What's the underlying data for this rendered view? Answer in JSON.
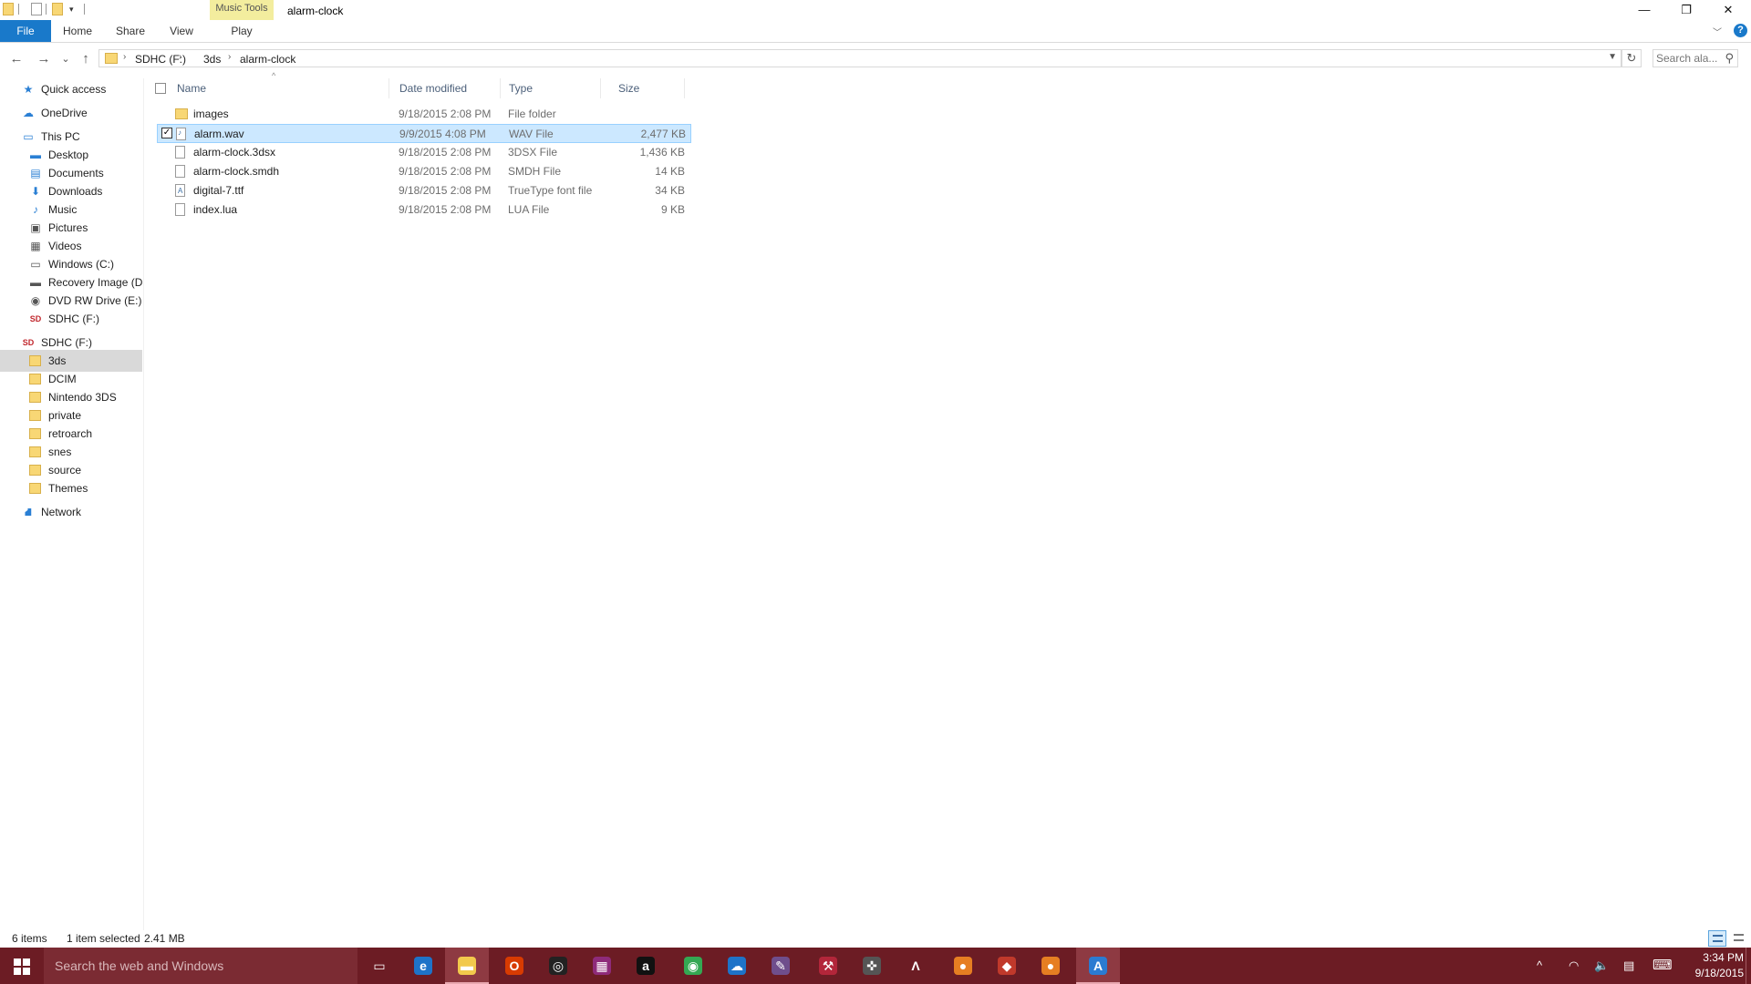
{
  "window": {
    "title": "alarm-clock",
    "contextual_tab_group": "Music Tools",
    "controls": {
      "minimize": "—",
      "restore": "❐",
      "close": "✕"
    }
  },
  "ribbon": {
    "tabs": [
      "File",
      "Home",
      "Share",
      "View",
      "Play"
    ],
    "collapse_icon": "chevron-down-icon",
    "help": "?"
  },
  "nav": {
    "back": "←",
    "forward": "→",
    "recent": "⌄",
    "up": "↑",
    "breadcrumb": [
      "SDHC (F:)",
      "3ds",
      "alarm-clock"
    ],
    "refresh": "↻"
  },
  "search": {
    "placeholder": "Search ala..."
  },
  "sidebar": {
    "items": [
      {
        "label": "Quick access",
        "icon": "star-icon",
        "glyph": "★"
      },
      {
        "label": "OneDrive",
        "icon": "cloud-icon",
        "glyph": "☁"
      },
      {
        "label": "This PC",
        "icon": "computer-icon",
        "glyph": "▭"
      },
      {
        "label": "Desktop",
        "icon": "desktop-icon",
        "glyph": "▬"
      },
      {
        "label": "Documents",
        "icon": "document-icon",
        "glyph": "▤"
      },
      {
        "label": "Downloads",
        "icon": "download-icon",
        "glyph": "⬇"
      },
      {
        "label": "Music",
        "icon": "music-icon",
        "glyph": "♪"
      },
      {
        "label": "Pictures",
        "icon": "picture-icon",
        "glyph": "▣"
      },
      {
        "label": "Videos",
        "icon": "video-icon",
        "glyph": "▦"
      },
      {
        "label": "Windows (C:)",
        "icon": "drive-icon",
        "glyph": "▭"
      },
      {
        "label": "Recovery Image (D:",
        "icon": "drive-icon",
        "glyph": "▬"
      },
      {
        "label": "DVD RW Drive (E:) A",
        "icon": "dvd-icon",
        "glyph": "◉"
      },
      {
        "label": "SDHC (F:)",
        "icon": "sd-card-icon",
        "glyph": "SD"
      },
      {
        "label": "SDHC (F:)",
        "icon": "sd-card-icon",
        "glyph": "SD"
      },
      {
        "label": "3ds",
        "icon": "folder-icon",
        "glyph": ""
      },
      {
        "label": "DCIM",
        "icon": "folder-icon",
        "glyph": ""
      },
      {
        "label": "Nintendo 3DS",
        "icon": "folder-icon",
        "glyph": ""
      },
      {
        "label": "private",
        "icon": "folder-icon",
        "glyph": ""
      },
      {
        "label": "retroarch",
        "icon": "folder-icon",
        "glyph": ""
      },
      {
        "label": "snes",
        "icon": "folder-icon",
        "glyph": ""
      },
      {
        "label": "source",
        "icon": "folder-icon",
        "glyph": ""
      },
      {
        "label": "Themes",
        "icon": "folder-icon",
        "glyph": ""
      },
      {
        "label": "Network",
        "icon": "network-icon",
        "glyph": "⛘"
      }
    ]
  },
  "filelist": {
    "headers": {
      "name": "Name",
      "date": "Date modified",
      "type": "Type",
      "size": "Size"
    },
    "sort_indicator": "^",
    "rows": [
      {
        "name": "images",
        "date": "9/18/2015 2:08 PM",
        "type": "File folder",
        "size": "",
        "icon": "folder-icon",
        "selected": false
      },
      {
        "name": "alarm.wav",
        "date": "9/9/2015 4:08 PM",
        "type": "WAV File",
        "size": "2,477 KB",
        "icon": "audio-file-icon",
        "selected": true
      },
      {
        "name": "alarm-clock.3dsx",
        "date": "9/18/2015 2:08 PM",
        "type": "3DSX File",
        "size": "1,436 KB",
        "icon": "file-icon",
        "selected": false
      },
      {
        "name": "alarm-clock.smdh",
        "date": "9/18/2015 2:08 PM",
        "type": "SMDH File",
        "size": "14 KB",
        "icon": "file-icon",
        "selected": false
      },
      {
        "name": "digital-7.ttf",
        "date": "9/18/2015 2:08 PM",
        "type": "TrueType font file",
        "size": "34 KB",
        "icon": "font-file-icon",
        "selected": false
      },
      {
        "name": "index.lua",
        "date": "9/18/2015 2:08 PM",
        "type": "LUA File",
        "size": "9 KB",
        "icon": "file-icon",
        "selected": false
      }
    ],
    "check_mark": "✓"
  },
  "status": {
    "item_count": "6 items",
    "selection": "1 item selected",
    "selection_size": "2.41 MB"
  },
  "taskbar": {
    "search_placeholder": "Search the web and Windows",
    "apps": [
      {
        "name": "task-view-icon",
        "glyph": "▭",
        "bg": ""
      },
      {
        "name": "edge-browser-icon",
        "glyph": "e",
        "bg": "#1e73c8"
      },
      {
        "name": "file-explorer-icon",
        "glyph": "▬",
        "bg": "#f2c94c"
      },
      {
        "name": "office-icon",
        "glyph": "O",
        "bg": "#d83b01"
      },
      {
        "name": "media-app-icon",
        "glyph": "◎",
        "bg": "#222222"
      },
      {
        "name": "game-app-icon",
        "glyph": "▦",
        "bg": "#8e2b7a"
      },
      {
        "name": "amazon-icon",
        "glyph": "a",
        "bg": "#111111"
      },
      {
        "name": "chrome-icon",
        "glyph": "◉",
        "bg": "#34a853"
      },
      {
        "name": "onedrive-icon",
        "glyph": "☁",
        "bg": "#1e73c8"
      },
      {
        "name": "paint-icon",
        "glyph": "✎",
        "bg": "#6f4e8c"
      },
      {
        "name": "tools-icon",
        "glyph": "⚒",
        "bg": "#b2263a"
      },
      {
        "name": "gamepad-icon",
        "glyph": "✜",
        "bg": "#555555"
      },
      {
        "name": "delta-app-icon",
        "glyph": "Λ",
        "bg": ""
      },
      {
        "name": "basketball-icon",
        "glyph": "●",
        "bg": "#e67e22"
      },
      {
        "name": "emulator-app-icon",
        "glyph": "◆",
        "bg": "#c0392b"
      },
      {
        "name": "ball-app-icon",
        "glyph": "●",
        "bg": "#e67e22"
      },
      {
        "name": "azure-app-icon",
        "glyph": "A",
        "bg": "#2b7bd1"
      }
    ],
    "tray": {
      "overflow": "^",
      "wifi": "◠",
      "volume": "🔈",
      "notifications": "▤",
      "keyboard": "⌨"
    },
    "time": "3:34 PM",
    "date": "9/18/2015"
  }
}
